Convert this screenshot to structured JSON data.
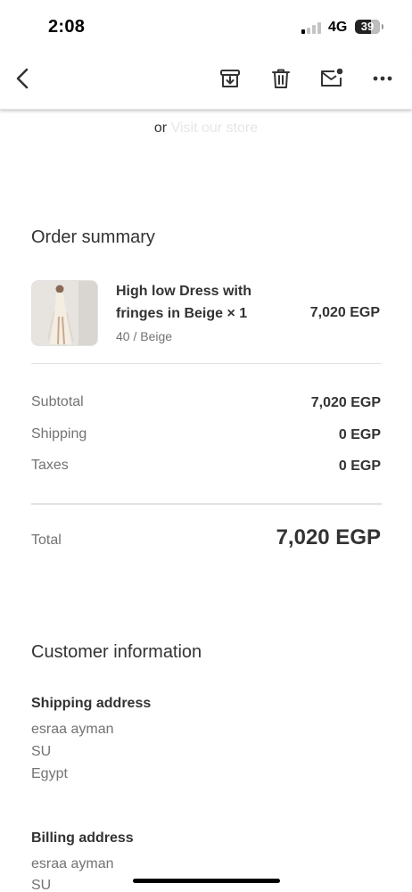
{
  "status_bar": {
    "time": "2:08",
    "network": "4G",
    "battery": "39",
    "signal_bars_active": 1,
    "signal_bars_total": 4
  },
  "toolbar": {
    "icons": [
      "back-arrow-icon",
      "archive-icon",
      "delete-icon",
      "mark-unread-icon",
      "more-options-icon"
    ]
  },
  "store_link": {
    "prefix": "or",
    "link": "Visit our store"
  },
  "order_summary": {
    "heading": "Order summary",
    "item": {
      "name": "High low Dress with fringes in Beige × 1",
      "variant": "40 / Beige",
      "price": "7,020 EGP"
    },
    "subtotal_label": "Subtotal",
    "subtotal_value": "7,020 EGP",
    "shipping_label": "Shipping",
    "shipping_value": "0 EGP",
    "taxes_label": "Taxes",
    "taxes_value": "0 EGP",
    "total_label": "Total",
    "total_value": "7,020 EGP"
  },
  "customer_information": {
    "heading": "Customer information",
    "shipping_address": {
      "title": "Shipping address",
      "lines": [
        "esraa ayman",
        "SU",
        "Egypt"
      ]
    },
    "billing_address": {
      "title": "Billing address",
      "lines": [
        "esraa ayman",
        "SU"
      ]
    }
  },
  "colors": {
    "text": "#333333",
    "muted": "#737373",
    "link_faded": "#e6e6e6",
    "divider": "#e1e1e1"
  }
}
